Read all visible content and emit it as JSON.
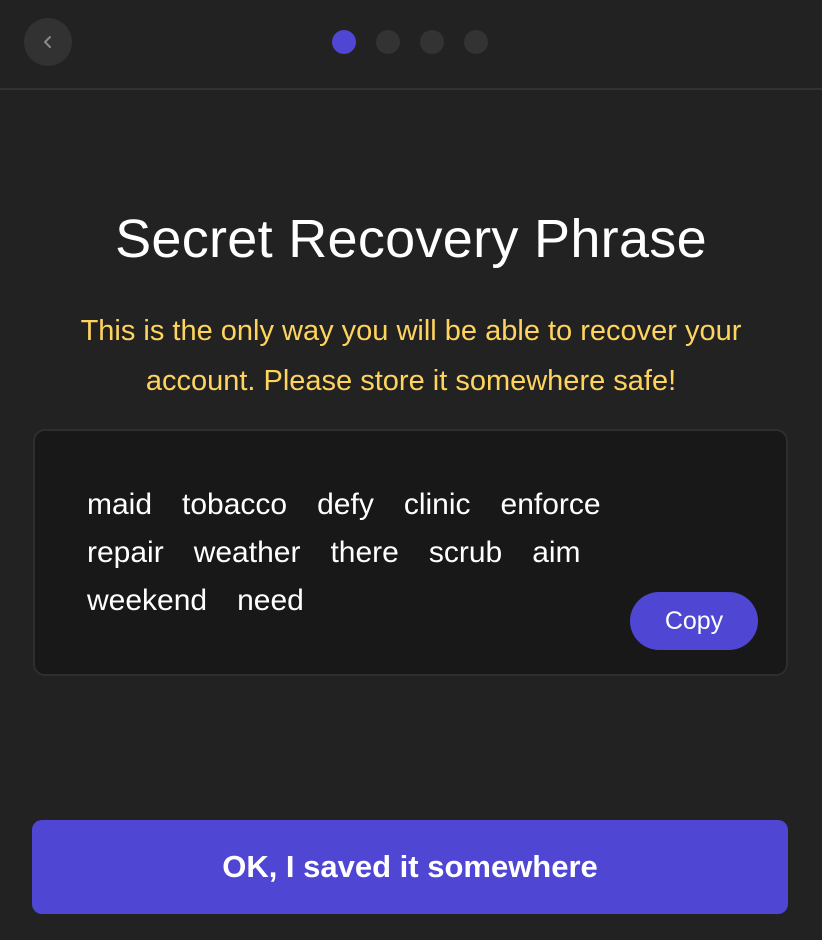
{
  "header": {
    "back_icon": "chevron-left-icon",
    "steps": {
      "total": 4,
      "current": 1
    },
    "colors": {
      "active": "#4f46d4",
      "inactive": "#333333"
    }
  },
  "title": "Secret Recovery Phrase",
  "subtitle": "This is the only way you will be able to recover your account. Please store it somewhere safe!",
  "phrase": {
    "words": [
      "maid",
      "tobacco",
      "defy",
      "clinic",
      "enforce",
      "repair",
      "weather",
      "there",
      "scrub",
      "aim",
      "weekend",
      "need"
    ],
    "copy_label": "Copy"
  },
  "confirm_label": "OK, I saved it somewhere",
  "colors": {
    "background": "#222222",
    "accent": "#4f46d4",
    "warning_text": "#ffd45e",
    "phrase_box": "#181818"
  }
}
